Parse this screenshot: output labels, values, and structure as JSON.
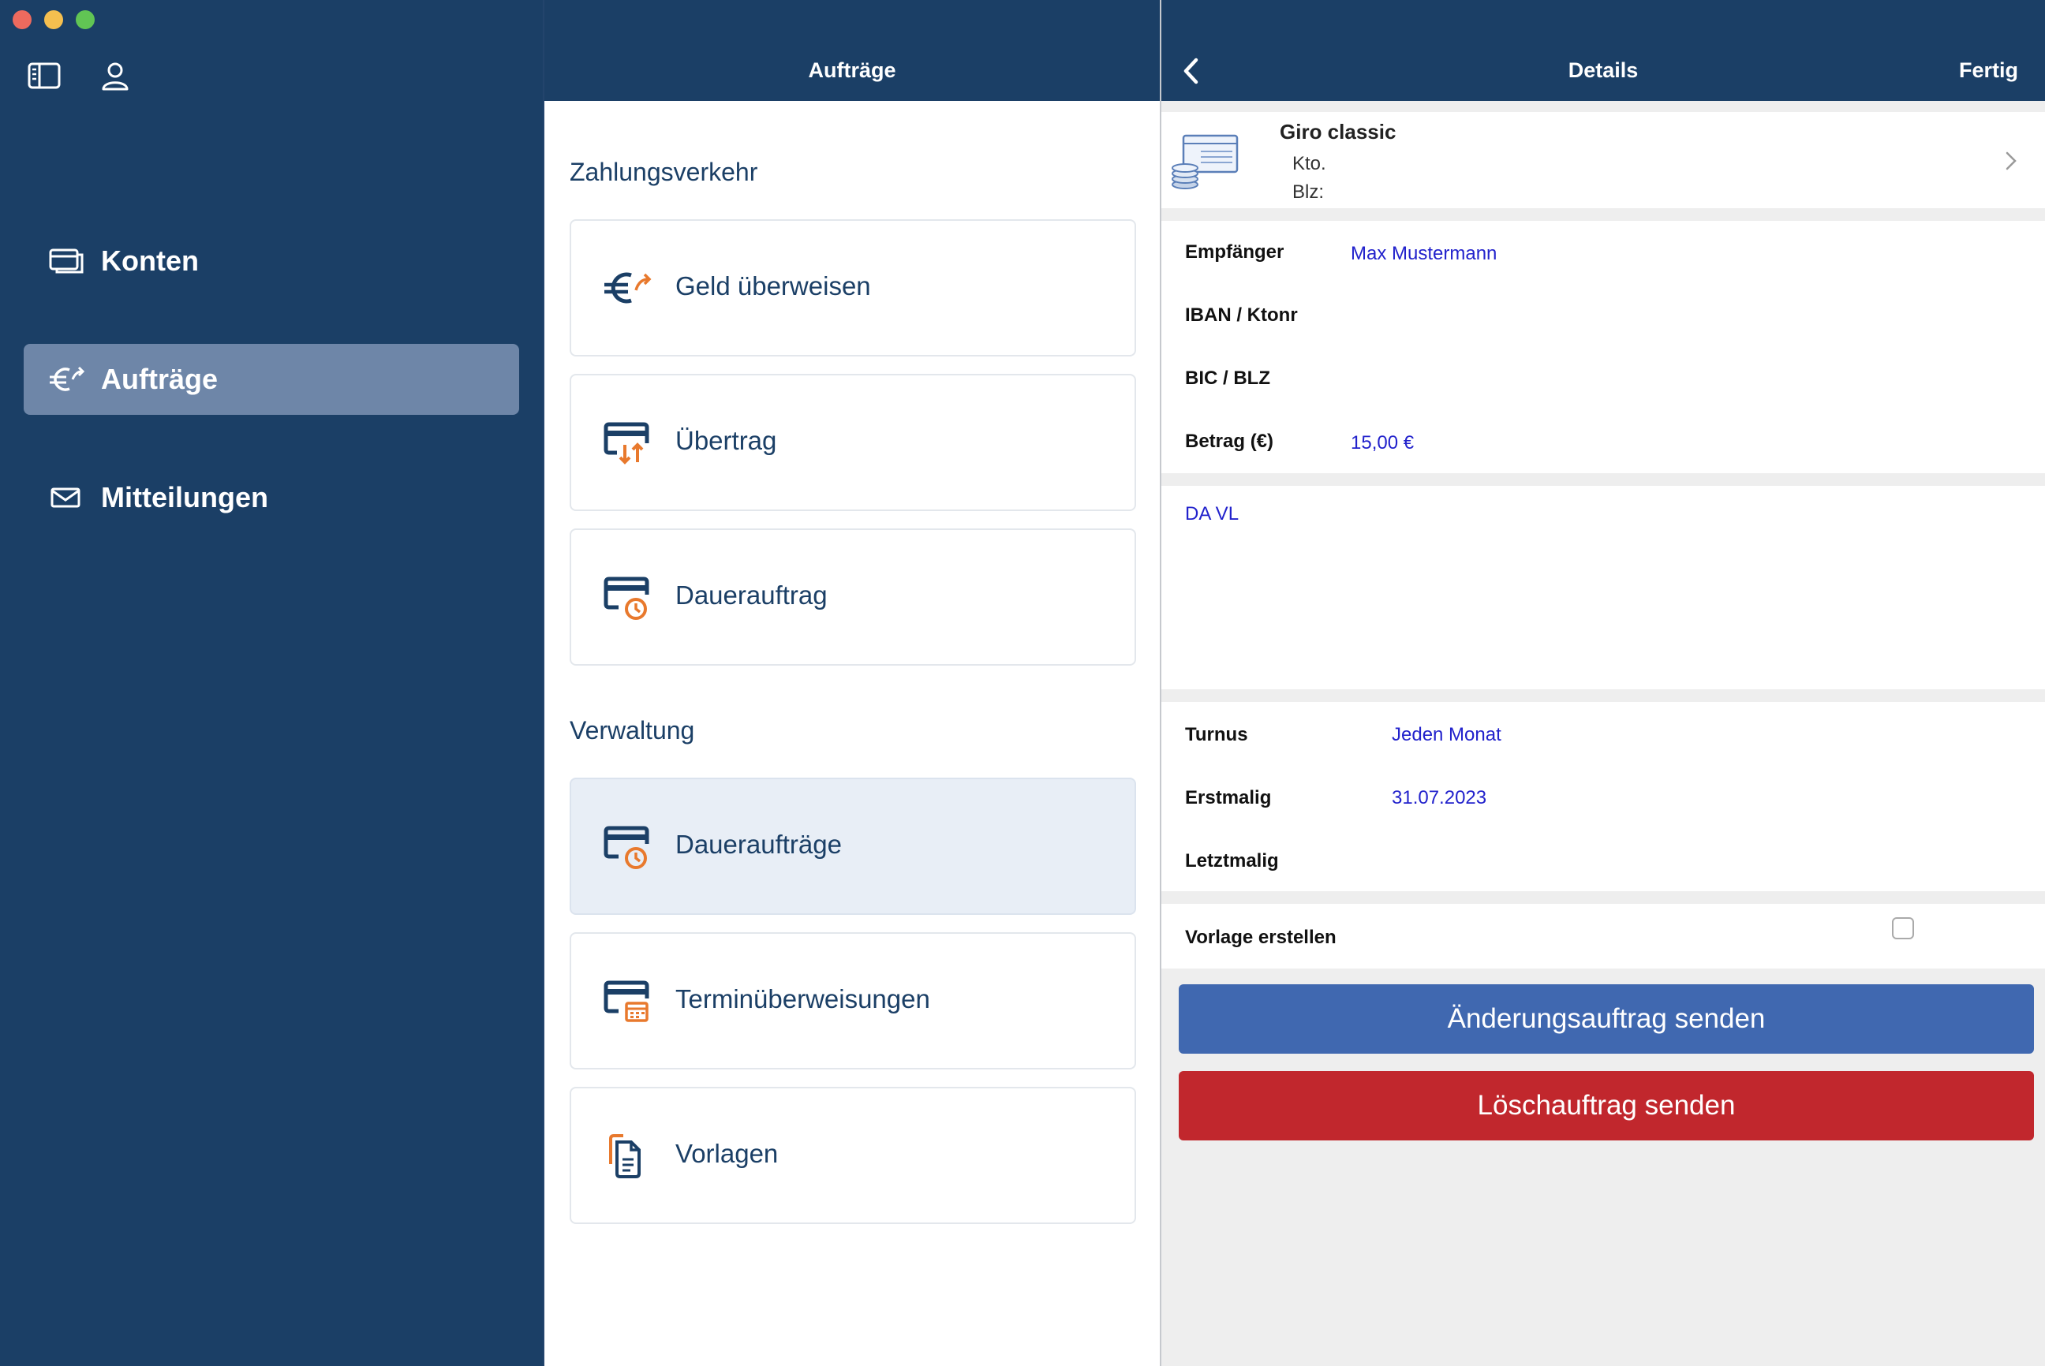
{
  "window": {
    "controls": [
      "close",
      "minimize",
      "maximize"
    ]
  },
  "toolbar": {
    "icons": [
      "sidebar-toggle-icon",
      "user-icon"
    ]
  },
  "sidebar": {
    "items": [
      {
        "label": "Konten",
        "icon": "accounts-icon",
        "selected": false
      },
      {
        "label": "Aufträge",
        "icon": "euro-transfer-icon",
        "selected": true
      },
      {
        "label": "Mitteilungen",
        "icon": "envelope-icon",
        "selected": false
      }
    ]
  },
  "middle": {
    "title": "Aufträge",
    "sections": [
      {
        "title": "Zahlungsverkehr",
        "items": [
          {
            "label": "Geld überweisen",
            "icon": "euro-transfer-icon"
          },
          {
            "label": "Übertrag",
            "icon": "card-transfer-icon"
          },
          {
            "label": "Dauerauftrag",
            "icon": "card-clock-icon"
          }
        ]
      },
      {
        "title": "Verwaltung",
        "items": [
          {
            "label": "Daueraufträge",
            "icon": "card-clock-icon",
            "selected": true
          },
          {
            "label": "Terminüberweisungen",
            "icon": "card-calendar-icon"
          },
          {
            "label": "Vorlagen",
            "icon": "documents-icon"
          }
        ]
      }
    ]
  },
  "detail": {
    "title": "Details",
    "done_label": "Fertig",
    "account": {
      "name": "Giro classic",
      "kto_label": "Kto.",
      "blz_label": "Blz:"
    },
    "fields": {
      "recipient_label": "Empfänger",
      "recipient_value": "Max Mustermann",
      "iban_label": "IBAN / Ktonr",
      "bic_label": "BIC / BLZ",
      "amount_label": "Betrag (€)",
      "amount_value": "15,00 €"
    },
    "purpose": "DA VL",
    "schedule": {
      "turnus_label": "Turnus",
      "turnus_value": "Jeden Monat",
      "first_label": "Erstmalig",
      "first_value": "31.07.2023",
      "last_label": "Letztmalig"
    },
    "template": {
      "label": "Vorlage erstellen",
      "checked": false
    },
    "buttons": {
      "change": "Änderungsauftrag senden",
      "delete": "Löschauftrag senden"
    }
  },
  "colors": {
    "navy": "#1b3f66",
    "sidebar_selected": "#6e86a8",
    "accent_orange": "#e8792d",
    "value_blue": "#2222cc",
    "button_blue": "#4068b0",
    "button_red": "#c1272d"
  }
}
